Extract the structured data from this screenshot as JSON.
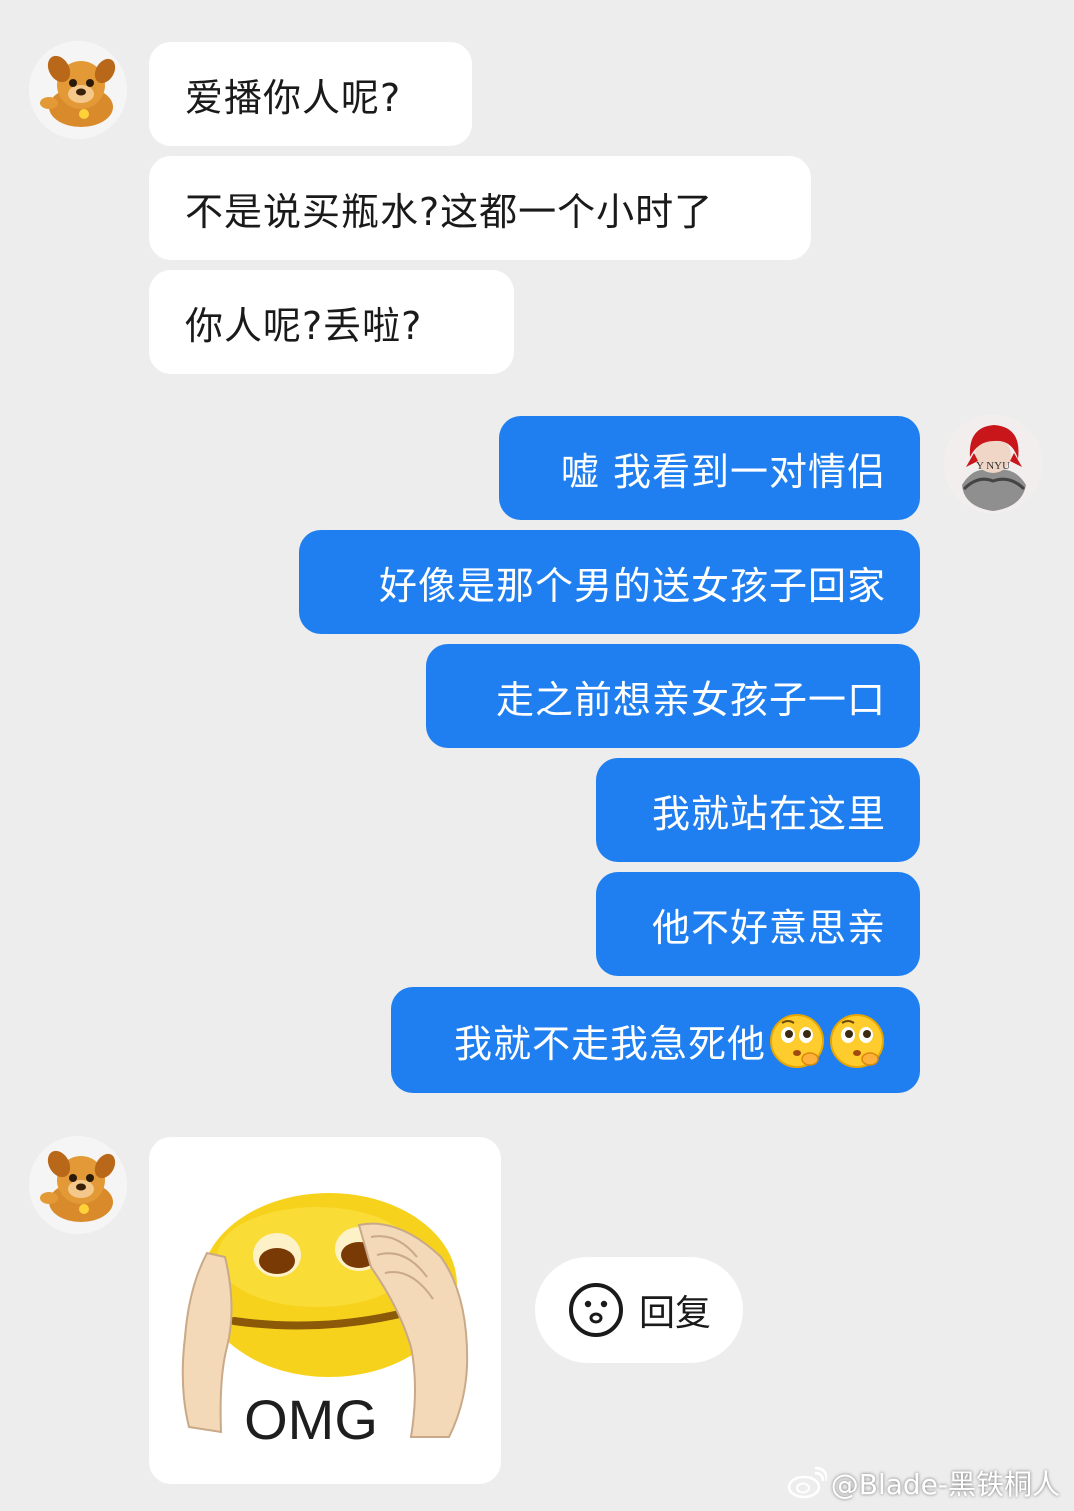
{
  "colors": {
    "background": "#ededed",
    "incoming_bubble": "#ffffff",
    "outgoing_bubble": "#1f7ff0",
    "outgoing_text": "#ffffff",
    "incoming_text": "#1a1a1a"
  },
  "contact": {
    "avatar_icon": "cartoon-dog-avatar"
  },
  "me": {
    "avatar_icon": "red-hair-anime-avatar",
    "avatar_text": "Y  NYU"
  },
  "messages_in": [
    "爱播你人呢?",
    "不是说买瓶水?这都一个小时了",
    "你人呢?丢啦?"
  ],
  "messages_out": [
    "嘘 我看到一对情侣",
    "好像是那个男的送女孩子回家",
    "走之前想亲女孩子一口",
    "我就站在这里",
    "他不好意思亲",
    "我就不走我急死他"
  ],
  "emoji_icon": "thinking-pleading-face-emoji",
  "sticker": {
    "icon": "omg-face-sticker",
    "text": "OMG"
  },
  "reply": {
    "icon": "smiley-face-icon",
    "label": "回复"
  },
  "watermark": {
    "icon": "weibo-logo-icon",
    "text": "@Blade-黑铁桐人"
  }
}
